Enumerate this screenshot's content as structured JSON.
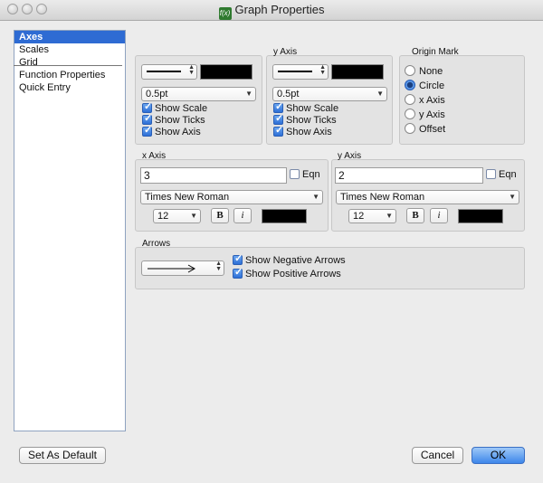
{
  "window": {
    "title": "Graph Properties",
    "app_icon_text": "f(x)"
  },
  "sidebar": {
    "items": [
      {
        "label": "Axes",
        "selected": true
      },
      {
        "label": "Scales",
        "selected": false
      },
      {
        "label": "Grid",
        "selected": false
      },
      {
        "label": "Function Properties",
        "selected": false
      },
      {
        "label": "Quick Entry",
        "selected": false
      }
    ]
  },
  "axes_top": {
    "x_axis": {
      "label": "",
      "thickness": "0.5pt",
      "show_scale": "Show Scale",
      "show_ticks": "Show Ticks",
      "show_axis": "Show Axis",
      "color": "#000000"
    },
    "y_axis": {
      "label": "y Axis",
      "thickness": "0.5pt",
      "show_scale": "Show Scale",
      "show_ticks": "Show Ticks",
      "show_axis": "Show Axis",
      "color": "#000000"
    }
  },
  "origin_mark": {
    "label": "Origin Mark",
    "options": [
      {
        "label": "None",
        "selected": false
      },
      {
        "label": "Circle",
        "selected": true
      },
      {
        "label": "x Axis",
        "selected": false
      },
      {
        "label": "y Axis",
        "selected": false
      },
      {
        "label": "Offset",
        "selected": false
      }
    ]
  },
  "labels_section": {
    "x_axis": {
      "label": "x Axis",
      "value": "3",
      "eqn_label": "Eqn",
      "font": "Times New Roman",
      "size": "12",
      "bold": "B",
      "italic": "i",
      "color": "#000000"
    },
    "y_axis": {
      "label": "y Axis",
      "value": "2",
      "eqn_label": "Eqn",
      "font": "Times New Roman",
      "size": "12",
      "bold": "B",
      "italic": "i",
      "color": "#000000"
    }
  },
  "arrows": {
    "label": "Arrows",
    "show_negative": "Show Negative Arrows",
    "show_positive": "Show Positive Arrows"
  },
  "footer": {
    "set_default": "Set As Default",
    "cancel": "Cancel",
    "ok": "OK"
  }
}
